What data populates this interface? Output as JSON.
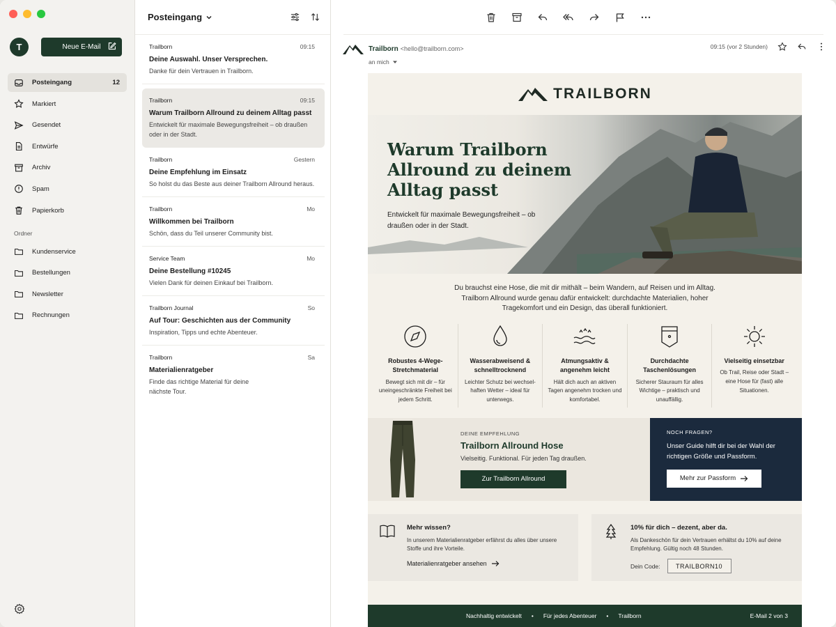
{
  "sidebar": {
    "avatar_initial": "T",
    "compose_label": "Neue E-Mail",
    "items": [
      {
        "label": "Posteingang",
        "count": "12"
      },
      {
        "label": "Markiert"
      },
      {
        "label": "Gesendet"
      },
      {
        "label": "Entwürfe"
      },
      {
        "label": "Archiv"
      },
      {
        "label": "Spam"
      },
      {
        "label": "Papierkorb"
      }
    ],
    "folders_heading": "Ordner",
    "folders": [
      "Kundenservice",
      "Bestellungen",
      "Newsletter",
      "Rechnungen"
    ]
  },
  "list": {
    "title": "Posteingang",
    "messages": [
      {
        "sender": "Trailborn",
        "time": "09:15",
        "subject": "Deine Auswahl. Unser Versprechen.",
        "preview": "Danke für dein Vertrauen in Trailborn."
      },
      {
        "sender": "Trailborn",
        "time": "09:15",
        "subject": "Warum Trailborn Allround zu deinem Alltag passt",
        "preview": "Entwickelt für maximale Bewegungsfreiheit – ob draußen oder in der Stadt."
      },
      {
        "sender": "Trailborn",
        "time": "Gestern",
        "subject": "Deine Empfehlung im Einsatz",
        "preview": "So holst du das Beste aus deiner Trailborn Allround heraus."
      },
      {
        "sender": "Trailborn",
        "time": "Mo",
        "subject": "Willkommen bei Trailborn",
        "preview": "Schön, dass du Teil unserer Community bist."
      },
      {
        "sender": "Service Team",
        "time": "Mo",
        "subject": "Deine Bestellung #10245",
        "preview": "Vielen Dank für deinen Einkauf bei Trailborn."
      },
      {
        "sender": "Trailborn Journal",
        "time": "So",
        "subject": "Auf Tour: Geschichten aus der Community",
        "preview": "Inspiration, Tipps und echte Abenteuer."
      },
      {
        "sender": "Trailborn",
        "time": "Sa",
        "subject": "Materialienratgeber",
        "preview": "Finde das richtige Material für deine nächste Tour."
      }
    ]
  },
  "reader": {
    "sender_name": "Trailborn",
    "sender_email": "<hello@trailborn.com>",
    "to": "an mich",
    "time": "09:15 (vor 2 Stunden)"
  },
  "email": {
    "brand": "TRAILBORN",
    "hero_title": "Warum Trailborn Allround zu deinem Alltag passt",
    "hero_sub": "Entwickelt für maximale Bewegungsfreiheit – ob draußen oder in der Stadt.",
    "intro": "Du brauchst eine Hose, die mit dir mithält – beim Wandern, auf Reisen und im Alltag. Trailborn Allround wurde genau dafür entwickelt: durchdachte Materialien, hoher Tragekomfort und ein Design, das überall funktioniert.",
    "features": [
      {
        "icon": "compass-icon",
        "title": "Robustes 4-Wege-Stretchmaterial",
        "text": "Bewegt sich mit dir – für uneingeschränkte Freiheit bei jedem Schritt."
      },
      {
        "icon": "droplet-icon",
        "title": "Wasserabweisend & schnelltrocknend",
        "text": "Leichter Schutz bei wechsel-haften Wetter – ideal für unterwegs."
      },
      {
        "icon": "airflow-icon",
        "title": "Atmungsaktiv & angenehm leicht",
        "text": "Hält dich auch an aktiven Tagen angenehm trocken und komfortabel."
      },
      {
        "icon": "pocket-icon",
        "title": "Durchdachte Taschenlösungen",
        "text": "Sicherer Stauraum für alles Wichtige – praktisch und unauffällig."
      },
      {
        "icon": "sun-icon",
        "title": "Vielseitig einsetzbar",
        "text": "Ob Trail, Reise oder Stadt – eine Hose für (fast) alle Situationen."
      }
    ],
    "promo_kicker": "DEINE EMPFEHLUNG",
    "promo_title": "Trailborn Allround Hose",
    "promo_text": "Vielseitig. Funktional. Für jeden Tag draußen.",
    "promo_cta": "Zur Trailborn Allround",
    "help_kicker": "NOCH FRAGEN?",
    "help_text": "Unser Guide hilft dir bei der Wahl der richtigen Größe und Passform.",
    "help_cta": "Mehr zur Passform",
    "card1_title": "Mehr wissen?",
    "card1_text": "In unserem Materialienratgeber erfährst du alles über unsere Stoffe und ihre Vorteile.",
    "card1_link": "Materialienratgeber ansehen",
    "card2_title": "10% für dich – dezent, aber da.",
    "card2_text": "Als Dankeschön für dein Vertrauen erhältst du 10% auf deine Empfehlung. Gültig noch 48 Stunden.",
    "card2_code_label": "Dein Code:",
    "card2_code": "TRAILBORN10",
    "footer_items": [
      "Nachhaltig entwickelt",
      "Für jedes Abenteuer",
      "Trailborn"
    ],
    "footer_count": "E-Mail 2 von 3"
  },
  "colors": {
    "brand_green": "#1e3a2b",
    "navy": "#1b2a3d",
    "cream": "#f4f1ea"
  }
}
